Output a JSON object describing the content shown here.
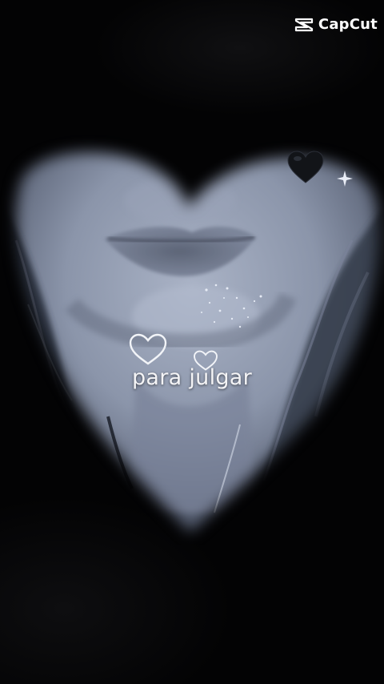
{
  "watermark": {
    "brand": "CapCut",
    "icon": "capcut-logo-icon"
  },
  "caption": {
    "text": "para julgar"
  },
  "stickers": [
    {
      "name": "outline-heart-large",
      "icon": "heart-outline-icon"
    },
    {
      "name": "outline-heart-small",
      "icon": "heart-outline-icon"
    },
    {
      "name": "black-heart",
      "icon": "black-heart-icon"
    },
    {
      "name": "sparkle",
      "icon": "sparkle-icon"
    }
  ],
  "colors": {
    "background": "#020203",
    "photo_tint": "#8e98ad",
    "text": "#f4f4f6"
  }
}
